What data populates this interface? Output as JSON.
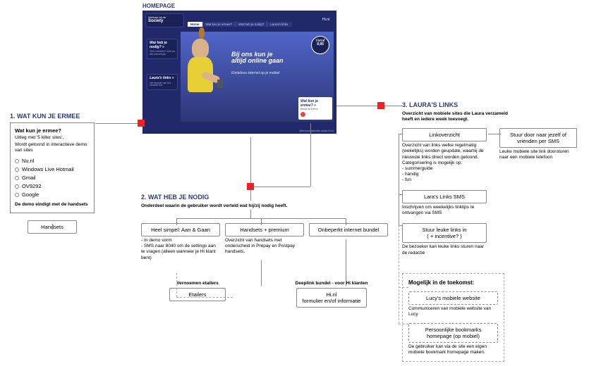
{
  "homepage": {
    "label": "HOMEPAGE",
    "logo_line1": "Welkom",
    "logo_line2": "bij de",
    "logo_brand": "Society",
    "nav": [
      "Home",
      "Wat kun je ermee?",
      "Wat heb je nodig?",
      "Laura's links"
    ],
    "hi_nl": "Hi.nl",
    "hero_line1": "Bij ons kun je",
    "hero_line2": "altijd online gaan",
    "hero_sub": "Eindeloos internet op je mobiel",
    "price_top": "Vanaf",
    "price_val": "9,95",
    "sidebox1_title": "Wat heb je nodig? »",
    "sidebox1_sub": "Snel checken? Geb uw dev keuzehulp",
    "sidebox2_title": "Laura's links »",
    "sidebox2_sub": "Het leukste van het mobiele net",
    "popup_title": "Wat kun je ermee? »",
    "popup_sub": "Bekijk de Demo",
    "footer": "Winvoorwaarden  www.Hi.nl"
  },
  "sec1": {
    "title": "1. WAT KUN JE ERMEE",
    "heading": "Wat kun je ermee?",
    "sub1": "Uitleg met '5 killer sites'.",
    "sub2": "Wordt getoond in interactieve demo van sites",
    "items": [
      "Nu.nl",
      "Windows Live Hotmail",
      "Gmail",
      "OV9292",
      "Google"
    ],
    "ending": "De demo eindigt met de handsets",
    "handsets": "Handsets"
  },
  "sec2": {
    "title": "2. WAT HEB JE NODIG",
    "sub": "Onderdeel waarin de gebruiker wordt verteld wat hij/zij nodig heeft.",
    "col1_box": "Heel simpel: Aan & Gaan",
    "col1_desc": "- In demo vorm\n- SMS naar 8040 om de settings aan te vragen (alleen wanneer je Hi klant bent)",
    "col2_box": "Handsets + premium",
    "col2_desc": "Overzicht van handsets met onderscheid in Prepay en Postpay handsets.",
    "col3_box": "Onbeperkt internet bundel",
    "sub_left_lbl": "Vernoemen etailers",
    "sub_left_box": "Etailers",
    "sub_right_lbl": "Deeplink bundel - voor Hi klanten",
    "sub_right_box": "Hi.nl\nformulier en/of informatie"
  },
  "sec3": {
    "title": "3. LAURA'S LINKS",
    "sub": "Overzicht van mobiele sites die Laura verzameld heeft en iedere week toevoegt.",
    "box1": "Linkoverzicht",
    "box1_desc": "Overzicht van links welke regelmatig (wekelijks) worden geupdate, waarbij de nieuwste links direct worden getoond. Categorisering is mogelijk op:\n- summerguide\n- handig\n- fun",
    "box1_right": "Stuur door naar jezelf of vrienden per SMS",
    "box1_right_desc": "Leuke mobiele site link doorsturen naar een mobiele telefoon",
    "box2": "Lara's Links SMS",
    "box2_desc": "Inschrijven om weekelijks linktips te ontvangen via SMS",
    "box3": "Stuur leuke links in\n( + incentive? )",
    "box3_desc": "De bezoeker kan leuke links sturen naar de redactie",
    "future_title": "Mogelijk in de toekomst:",
    "future1": "Lucy's mobiele website",
    "future1_desc": "Communiceren van mobiele website van Lucy",
    "future2": "Persoonlijke bookmarks homepage (op mobiel)",
    "future2_desc": "De gebruiker kan via de site een eigen mobiele bookmark homepage maken."
  }
}
